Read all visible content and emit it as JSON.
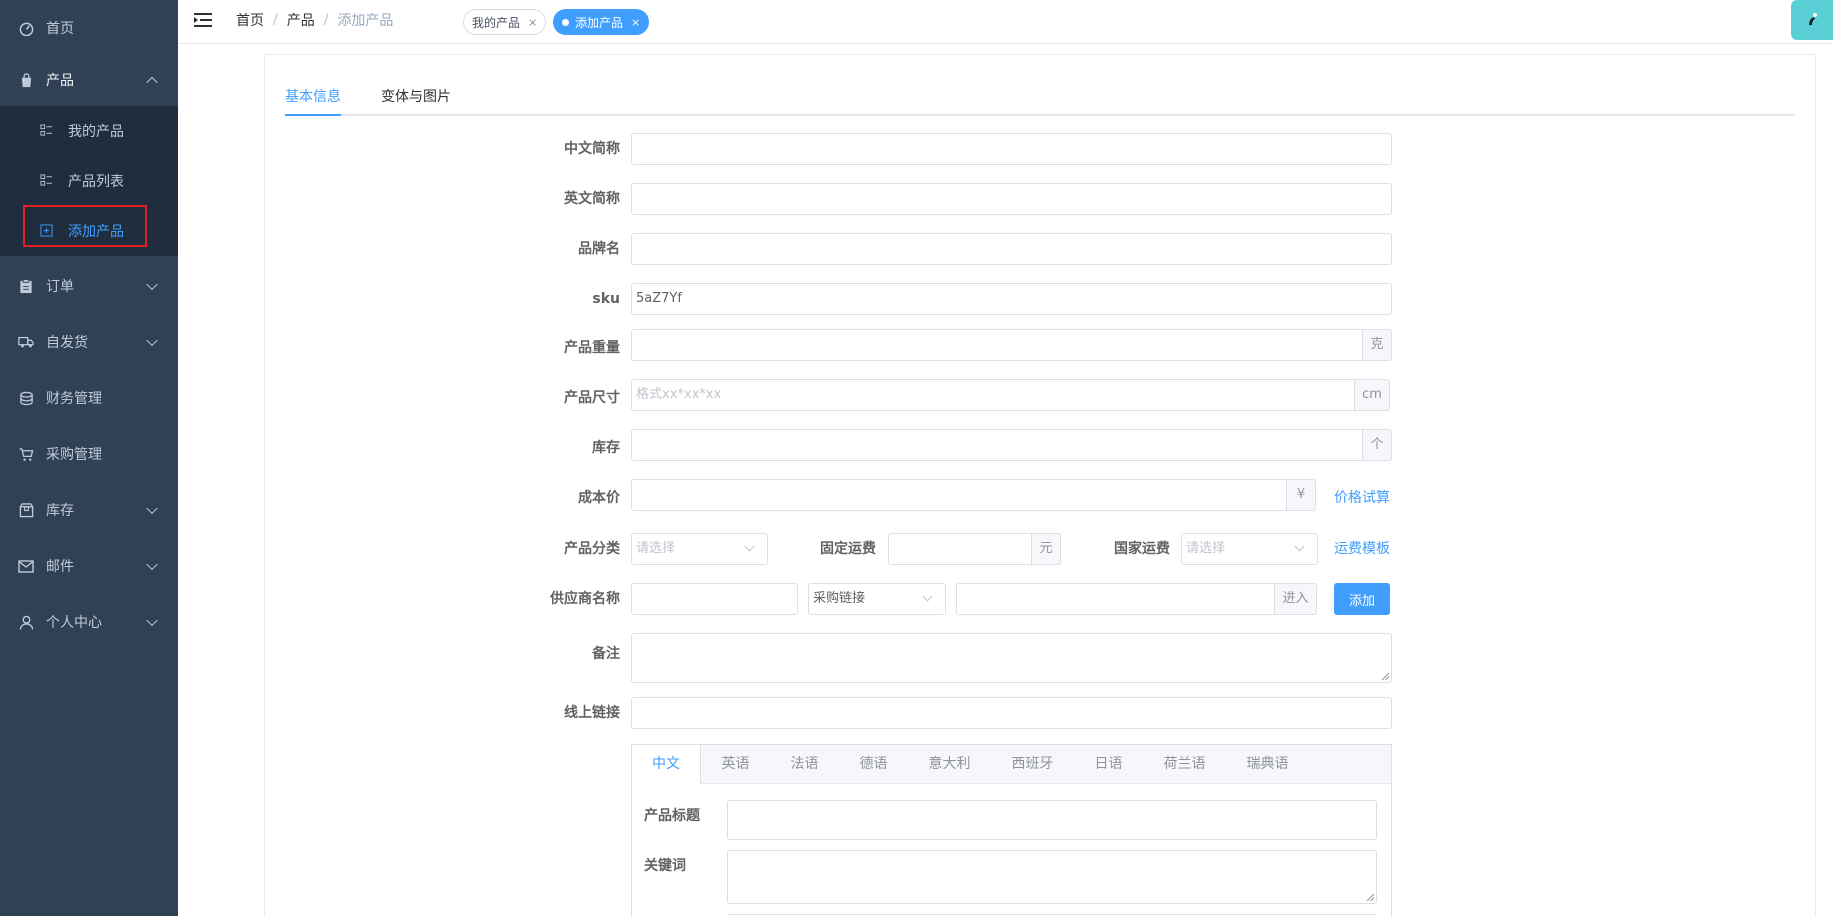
{
  "sidebar": {
    "items": [
      {
        "label": "首页",
        "icon": "dashboard-icon"
      },
      {
        "label": "产品",
        "icon": "shopping-bag-icon"
      },
      {
        "label": "订单",
        "icon": "clipboard-icon"
      },
      {
        "label": "自发货",
        "icon": "truck-icon"
      },
      {
        "label": "财务管理",
        "icon": "coins-icon"
      },
      {
        "label": "采购管理",
        "icon": "cart-icon"
      },
      {
        "label": "库存",
        "icon": "box-icon"
      },
      {
        "label": "邮件",
        "icon": "mail-icon"
      },
      {
        "label": "个人中心",
        "icon": "user-icon"
      }
    ],
    "submenu": [
      {
        "label": "我的产品"
      },
      {
        "label": "产品列表"
      },
      {
        "label": "添加产品"
      }
    ]
  },
  "topbar": {
    "breadcrumb": [
      "首页",
      "产品",
      "添加产品"
    ],
    "separator": "/",
    "tags": [
      "我的产品",
      "添加产品"
    ],
    "tag_close": "×"
  },
  "tabs": [
    "基本信息",
    "变体与图片"
  ],
  "form": {
    "cn_name": {
      "label": "中文简称",
      "value": ""
    },
    "en_name": {
      "label": "英文简称",
      "value": ""
    },
    "brand": {
      "label": "品牌名",
      "value": ""
    },
    "sku": {
      "label": "sku",
      "value": "5aZ7Yf"
    },
    "weight": {
      "label": "产品重量",
      "value": "",
      "suffix": "克"
    },
    "size": {
      "label": "产品尺寸",
      "placeholder": "格式xx*xx*xx",
      "suffix": "cm"
    },
    "stock": {
      "label": "库存",
      "value": "",
      "suffix": "个"
    },
    "cost": {
      "label": "成本价",
      "value": "",
      "suffix": "¥",
      "link": "价格试算"
    },
    "category": {
      "label": "产品分类",
      "placeholder": "请选择"
    },
    "fixed_shipping": {
      "label": "固定运费",
      "value": "",
      "suffix": "元"
    },
    "country_shipping": {
      "label": "国家运费",
      "placeholder": "请选择",
      "link": "运费模板"
    },
    "supplier": {
      "label": "供应商名称",
      "value": "",
      "select": "采购链接",
      "suffix": "进入",
      "button": "添加"
    },
    "remark": {
      "label": "备注"
    },
    "online_link": {
      "label": "线上链接",
      "value": ""
    }
  },
  "languages": [
    "中文",
    "英语",
    "法语",
    "德语",
    "意大利",
    "西班牙",
    "日语",
    "荷兰语",
    "瑞典语"
  ],
  "lang_form": {
    "title_label": "产品标题",
    "keyword_label": "关键词"
  },
  "colors": {
    "sidebar": "#304156",
    "submenu": "#1f2d3d",
    "accent": "#409eff",
    "highlight": "#e02020"
  }
}
